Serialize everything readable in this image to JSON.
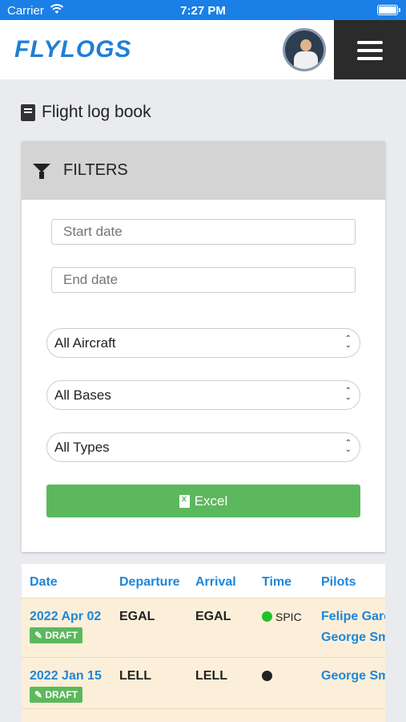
{
  "status_bar": {
    "carrier": "Carrier",
    "time": "7:27 PM"
  },
  "header": {
    "logo": "FLYLOGS"
  },
  "page": {
    "title": "Flight log book"
  },
  "filters": {
    "heading": "FILTERS",
    "start_date_placeholder": "Start date",
    "end_date_placeholder": "End date",
    "aircraft_select": "All Aircraft",
    "bases_select": "All Bases",
    "types_select": "All Types",
    "excel_button": "Excel"
  },
  "table": {
    "columns": [
      "Date",
      "Departure",
      "Arrival",
      "Time",
      "Pilots"
    ],
    "rows": [
      {
        "date": "2022 Apr 02",
        "badge": "DRAFT",
        "departure": "EGAL",
        "arrival": "EGAL",
        "time_text": "SPIC",
        "time_dot_color": "#22c02a",
        "pilots": [
          "Felipe Garc",
          "George Sm"
        ]
      },
      {
        "date": "2022 Jan 15",
        "badge": "DRAFT",
        "departure": "LELL",
        "arrival": "LELL",
        "time_text": "",
        "time_dot_color": "#222222",
        "pilots": [
          "George Sm"
        ]
      }
    ]
  },
  "colors": {
    "accent": "#1f86d9",
    "status_bar": "#1a7fe6",
    "success": "#5cb85c",
    "row_highlight": "#fcefd9"
  }
}
